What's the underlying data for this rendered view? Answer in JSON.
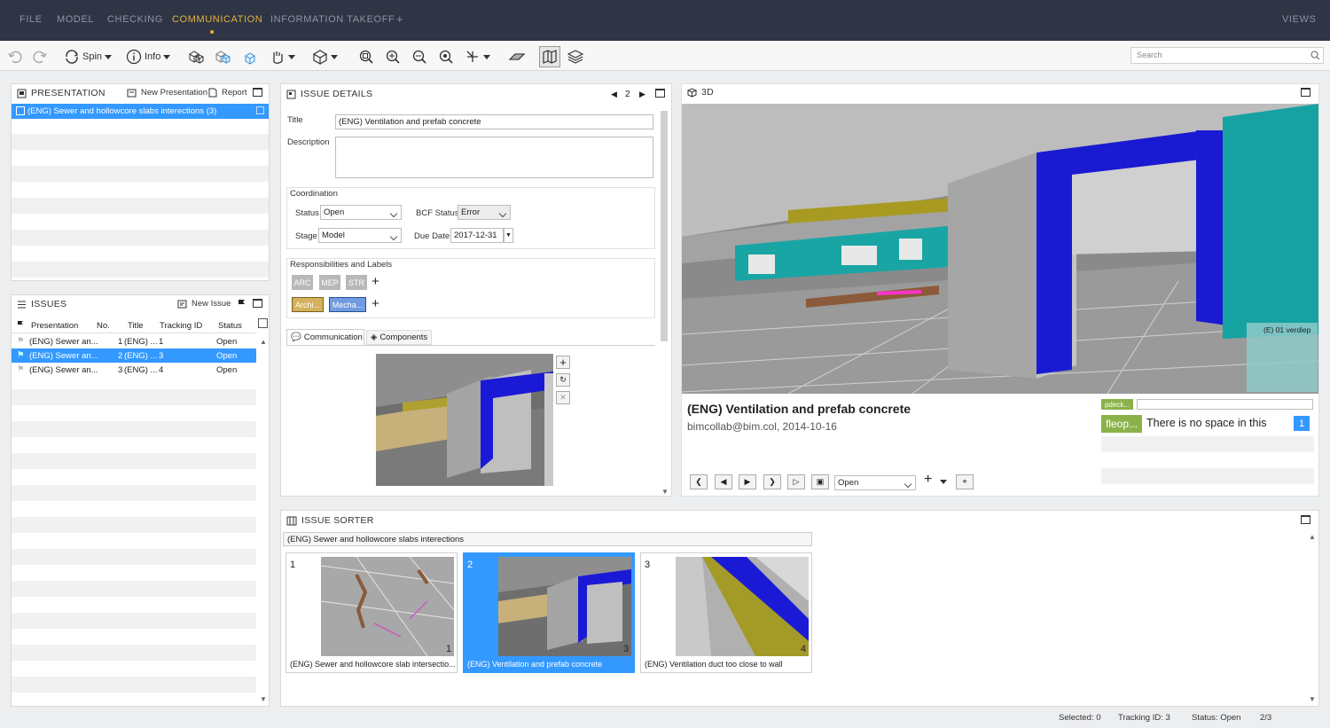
{
  "menu": {
    "items": [
      "FILE",
      "MODEL",
      "CHECKING",
      "COMMUNICATION",
      "INFORMATION TAKEOFF",
      "+"
    ],
    "active_index": 3,
    "views": "VIEWS"
  },
  "toolbar": {
    "spin_label": "Spin",
    "info_label": "Info",
    "search_placeholder": "Search"
  },
  "presentation": {
    "title": "PRESENTATION",
    "new_label": "New Presentation",
    "report_label": "Report",
    "items": [
      "(ENG) Sewer and hollowcore slabs interections (3)"
    ]
  },
  "issues": {
    "title": "ISSUES",
    "new_label": "New Issue",
    "columns": [
      "Presentation",
      "No.",
      "Title",
      "Tracking ID",
      "Status"
    ],
    "rows": [
      {
        "presentation": "(ENG) Sewer an...",
        "no": "1",
        "title": "(ENG) ...",
        "tracking": "1",
        "status": "Open"
      },
      {
        "presentation": "(ENG) Sewer an...",
        "no": "2",
        "title": "(ENG) ...",
        "tracking": "3",
        "status": "Open"
      },
      {
        "presentation": "(ENG) Sewer an...",
        "no": "3",
        "title": "(ENG) ...",
        "tracking": "4",
        "status": "Open"
      }
    ],
    "selected_index": 1
  },
  "details": {
    "title": "ISSUE DETAILS",
    "page": "2",
    "title_label": "Title",
    "title_value": "(ENG) Ventilation and prefab concrete",
    "description_label": "Description",
    "coordination_label": "Coordination",
    "status_label": "Status",
    "status_value": "Open",
    "bcf_label": "BCF Status",
    "bcf_value": "Error",
    "stage_label": "Stage",
    "stage_value": "Model",
    "due_label": "Due Date",
    "due_value": "2017-12-31",
    "resp_label": "Responsibilities and Labels",
    "resp_tags": [
      "ARC",
      "MEP",
      "STR"
    ],
    "label_tags": [
      "Archi...",
      "Mecha..."
    ],
    "tabs": [
      "Communication",
      "Components"
    ]
  },
  "view3d": {
    "title": "3D",
    "minimap_label": "(E) 01 verdiep",
    "issue_title": "(ENG) Ventilation and prefab concrete",
    "issue_meta": "bimcollab@bim.col, 2014-10-16",
    "status_value": "Open",
    "comment_tag_small": "pdeck...",
    "comment_tag": "fleop...",
    "comment_text": "There is no space in this",
    "comment_count": "1"
  },
  "sorter": {
    "title": "ISSUE SORTER",
    "group": "(ENG) Sewer and hollowcore slabs interections",
    "cards": [
      {
        "num": "1",
        "corner": "1",
        "caption": "(ENG) Sewer and hollowcore slab intersectio..."
      },
      {
        "num": "2",
        "corner": "3",
        "caption": "(ENG) Ventilation and prefab concrete"
      },
      {
        "num": "3",
        "corner": "4",
        "caption": "(ENG) Ventilation duct too close to wall"
      }
    ],
    "selected_index": 1
  },
  "status": {
    "selected": "Selected: 0",
    "tracking": "Tracking ID: 3",
    "status": "Status: Open",
    "page": "2/3"
  },
  "colors": {
    "menubar": "#2f3544",
    "accent": "#e2b33c",
    "selection": "#3399ff",
    "tag_gray": "#b8b8b8",
    "tag_archi": "#d4b15c",
    "tag_mecha": "#6f9be0",
    "comment_green": "#8bb24a"
  }
}
